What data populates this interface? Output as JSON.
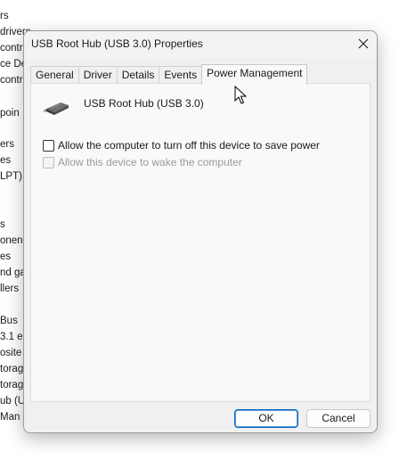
{
  "background_list": {
    "items": [
      {
        "label": "rs"
      },
      {
        "label": "drivers"
      },
      {
        "label": "contr"
      },
      {
        "label": "ce De"
      },
      {
        "label": "contr"
      },
      {
        "label": "poin"
      },
      {
        "label": "ers"
      },
      {
        "label": "es"
      },
      {
        "label": "LPT)"
      },
      {
        "label": "s"
      },
      {
        "label": "onen"
      },
      {
        "label": "es"
      },
      {
        "label": "nd ga"
      },
      {
        "label": "llers"
      },
      {
        "label": "Bus"
      },
      {
        "label": "3.1 e"
      },
      {
        "label": "osite"
      },
      {
        "label": "torag"
      },
      {
        "label": "torag"
      },
      {
        "label": "ub (U"
      },
      {
        "label": "Man"
      }
    ]
  },
  "dialog": {
    "title": "USB Root Hub (USB 3.0) Properties",
    "close_icon": "close-icon",
    "tabs": [
      {
        "label": "General",
        "active": false
      },
      {
        "label": "Driver",
        "active": false
      },
      {
        "label": "Details",
        "active": false
      },
      {
        "label": "Events",
        "active": false
      },
      {
        "label": "Power Management",
        "active": true
      }
    ],
    "device": {
      "icon": "usb-hub-icon",
      "name": "USB Root Hub (USB 3.0)"
    },
    "options": [
      {
        "label": "Allow the computer to turn off this device to save power",
        "checked": false,
        "enabled": true
      },
      {
        "label": "Allow this device to wake the computer",
        "checked": false,
        "enabled": false
      }
    ],
    "buttons": {
      "ok": "OK",
      "cancel": "Cancel"
    }
  }
}
